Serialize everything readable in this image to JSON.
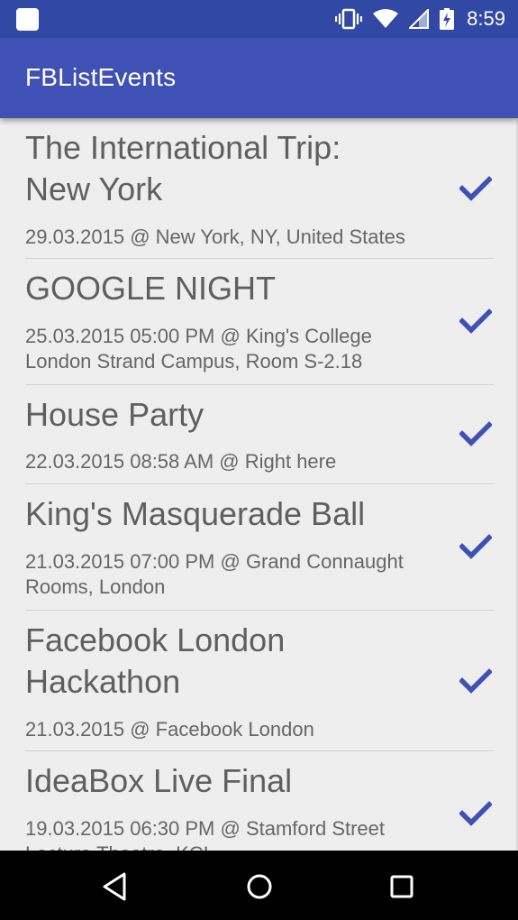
{
  "status_bar": {
    "time": "8:59",
    "icons": [
      "app-notification-icon",
      "vibrate-icon",
      "wifi-icon",
      "signal-icon",
      "battery-charging-icon"
    ]
  },
  "app_bar": {
    "title": "FBListEvents"
  },
  "events": [
    {
      "title_lines": [
        "The International Trip:",
        "New York"
      ],
      "detail_lines": [
        "29.03.2015 @ New York, NY, United States"
      ],
      "selected": true
    },
    {
      "title_lines": [
        "GOOGLE NIGHT"
      ],
      "detail_lines": [
        "25.03.2015 05:00 PM @ King's College",
        "London Strand Campus, Room S-2.18"
      ],
      "selected": true
    },
    {
      "title_lines": [
        "House Party"
      ],
      "detail_lines": [
        "22.03.2015 08:58 AM @ Right here"
      ],
      "selected": true
    },
    {
      "title_lines": [
        "King's Masquerade Ball"
      ],
      "detail_lines": [
        "21.03.2015 07:00 PM @ Grand Connaught",
        "Rooms, London"
      ],
      "selected": true
    },
    {
      "title_lines": [
        "Facebook London",
        "Hackathon"
      ],
      "detail_lines": [
        "21.03.2015 @ Facebook London"
      ],
      "selected": true
    },
    {
      "title_lines": [
        "IdeaBox Live Final"
      ],
      "detail_lines": [
        "19.03.2015 06:30 PM @ Stamford Street",
        "Lecture Theatre, KCL"
      ],
      "selected": true
    }
  ],
  "colors": {
    "status_bar": "#3149a5",
    "app_bar": "#3f51b5",
    "accent_check": "#3f51b5",
    "background": "#eeeeee"
  },
  "nav_bar": {
    "buttons": [
      "back-icon",
      "home-icon",
      "recents-icon"
    ]
  }
}
